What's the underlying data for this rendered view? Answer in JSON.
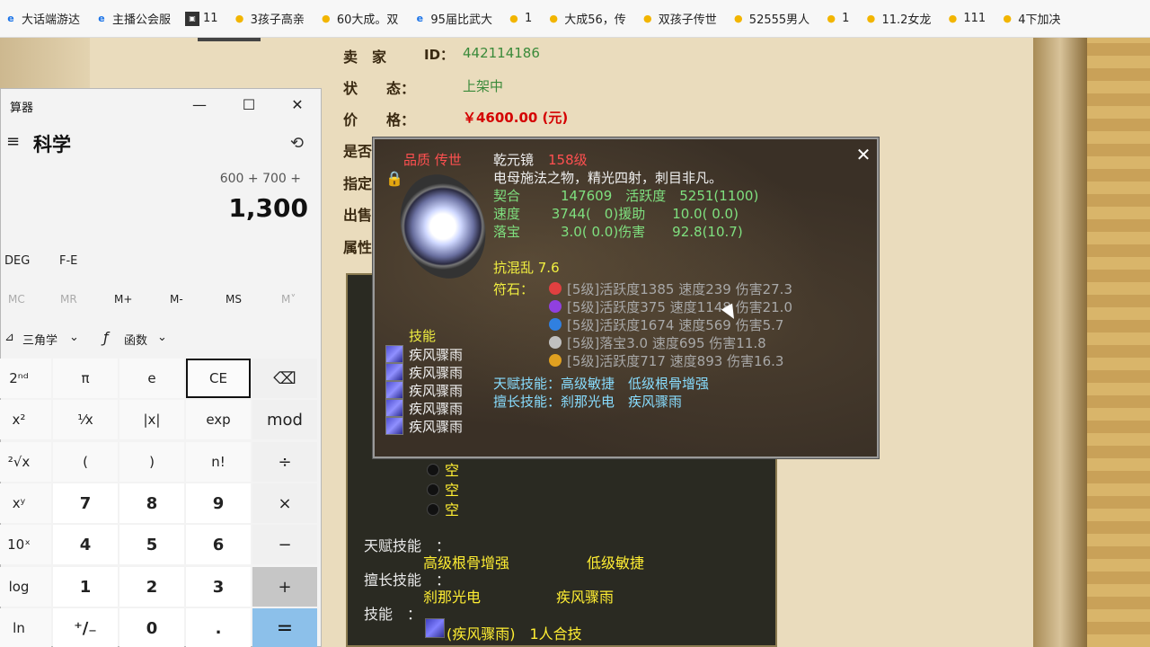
{
  "bookmarks": [
    {
      "label": "大话端游达",
      "icon": "browser-icon"
    },
    {
      "label": "主播公会服",
      "icon": "browser-icon"
    },
    {
      "label": "11",
      "icon": "thumbnail-icon"
    },
    {
      "label": "3孩子高亲",
      "icon": "chick-icon"
    },
    {
      "label": "60大成。双",
      "icon": "chick-icon"
    },
    {
      "label": "95届比武大",
      "icon": "browser-icon"
    },
    {
      "label": "1",
      "icon": "chick-icon"
    },
    {
      "label": "大成56，传",
      "icon": "chick-icon"
    },
    {
      "label": "双孩子传世",
      "icon": "chick-icon"
    },
    {
      "label": "52555男人",
      "icon": "chick-icon"
    },
    {
      "label": "1",
      "icon": "chick-icon"
    },
    {
      "label": "11.2女龙",
      "icon": "chick-icon"
    },
    {
      "label": "111",
      "icon": "chick-icon"
    },
    {
      "label": "4下加决",
      "icon": "chick-icon"
    }
  ],
  "listing": {
    "seller_label": "卖　家",
    "seller_id_label": "ID：",
    "seller_id": "442114186",
    "status_label": "状　　态：",
    "status": "上架中",
    "price_label": "价　　格：",
    "price": "￥4600.00 (元)",
    "row4_label": "是否",
    "row5_label": "指定",
    "row6_label": "出售",
    "row7_label": "属性"
  },
  "lower_panel": {
    "rune_slots": [
      "空",
      "空",
      "空"
    ],
    "talent_label": "天赋技能　：",
    "talent_1": "高级根骨增强",
    "talent_2": "低级敏捷",
    "specialty_label": "擅长技能　：",
    "specialty_1": "刹那光电",
    "specialty_2": "疾风骤雨",
    "skills_label": "技能　：",
    "skill_1": "(疾风骤雨)　1人合技"
  },
  "tooltip": {
    "quality": "品质 传世",
    "name": "乾元镜",
    "level": "158级",
    "description": "电母施法之物，精光四射，刺目非凡。",
    "stat_line_1": "契合　　　147609　活跃度　5251(1100)",
    "stat_line_2": "速度　　 3744(　0)援助　　10.0( 0.0)",
    "stat_line_3": "落宝　　　3.0( 0.0)伤害　　92.8(10.7)",
    "resist": "抗混乱 7.6",
    "runes_label": "符石：",
    "runes": [
      {
        "text": "[5级]活跃度1385 速度239 伤害27.3",
        "color": "#e04040"
      },
      {
        "text": "[5级]活跃度375 速度1148 伤害21.0",
        "color": "#9040e0"
      },
      {
        "text": "[5级]活跃度1674 速度569 伤害5.7",
        "color": "#3080e0"
      },
      {
        "text": "[5级]落宝3.0 速度695 伤害11.8",
        "color": "#c0c0c0"
      },
      {
        "text": "[5级]活跃度717 速度893 伤害16.3",
        "color": "#e0a020"
      }
    ],
    "skills_title": "技能",
    "skills": [
      "疾风骤雨",
      "疾风骤雨",
      "疾风骤雨",
      "疾风骤雨",
      "疾风骤雨"
    ],
    "talent_line": "天赋技能：高级敏捷　低级根骨增强",
    "specialty_line": "擅长技能：刹那光电　疾风骤雨",
    "close_symbol": "✕"
  },
  "calculator": {
    "title": "算器",
    "mode": "科学",
    "expression": "600 + 700 +",
    "result": "1,300",
    "angle_unit": "DEG",
    "fe": "F-E",
    "memory": [
      "MC",
      "MR",
      "M+",
      "M-",
      "MS",
      "M˅"
    ],
    "memory_enabled": [
      false,
      false,
      true,
      true,
      true,
      false
    ],
    "trig_label": "三角学",
    "func_label": "函数",
    "keys": [
      [
        "2ⁿᵈ",
        "π",
        "e",
        "CE",
        "⌫"
      ],
      [
        "x²",
        "¹⁄x",
        "|x|",
        "exp",
        "mod"
      ],
      [
        "²√x",
        "(",
        ")",
        "n!",
        "÷"
      ],
      [
        "xʸ",
        "7",
        "8",
        "9",
        "×"
      ],
      [
        "10ˣ",
        "4",
        "5",
        "6",
        "−"
      ],
      [
        "log",
        "1",
        "2",
        "3",
        "+"
      ],
      [
        "ln",
        "⁺∕₋",
        "0",
        ".",
        "="
      ]
    ],
    "win_min": "—",
    "win_max": "☐",
    "win_close": "✕"
  }
}
